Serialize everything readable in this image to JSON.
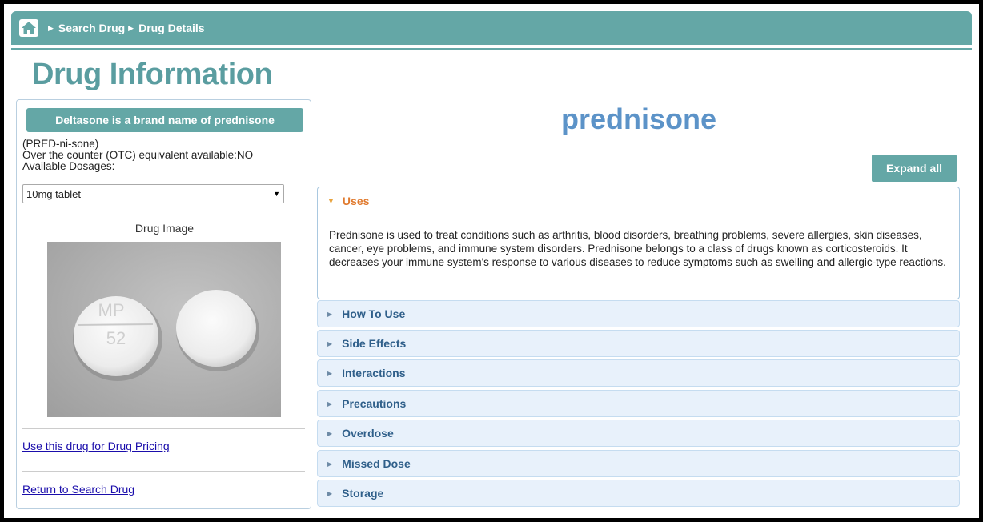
{
  "breadcrumb": {
    "items": [
      "Search Drug",
      "Drug Details"
    ]
  },
  "page_title": "Drug Information",
  "left_panel": {
    "brand_banner": "Deltasone is a brand name of prednisone",
    "pronunciation": "(PRED-ni-sone)",
    "otc_line": "Over the counter (OTC) equivalent available:NO",
    "dosages_label": "Available Dosages:",
    "dosage_selected": "10mg tablet",
    "image_caption": "Drug Image",
    "pill_imprint_line1": "MP",
    "pill_imprint_line2": "52",
    "link_pricing": "Use this drug for Drug Pricing",
    "link_return": "Return to Search Drug"
  },
  "drug_name": "prednisone",
  "expand_all_label": "Expand all",
  "accordion": {
    "open_section": {
      "title": "Uses",
      "body": "Prednisone is used to treat conditions such as arthritis, blood disorders, breathing problems, severe allergies, skin diseases, cancer, eye problems, and immune system disorders. Prednisone belongs to a class of drugs known as corticosteroids. It decreases your immune system's response to various diseases to reduce symptoms such as swelling and allergic-type reactions."
    },
    "sections": [
      "How To Use",
      "Side Effects",
      "Interactions",
      "Precautions",
      "Overdose",
      "Missed Dose",
      "Storage"
    ]
  },
  "colors": {
    "teal": "#64a7a6",
    "title_teal": "#5a9da0",
    "drug_name_blue": "#5c93c8",
    "open_section_orange": "#e07a2e"
  }
}
